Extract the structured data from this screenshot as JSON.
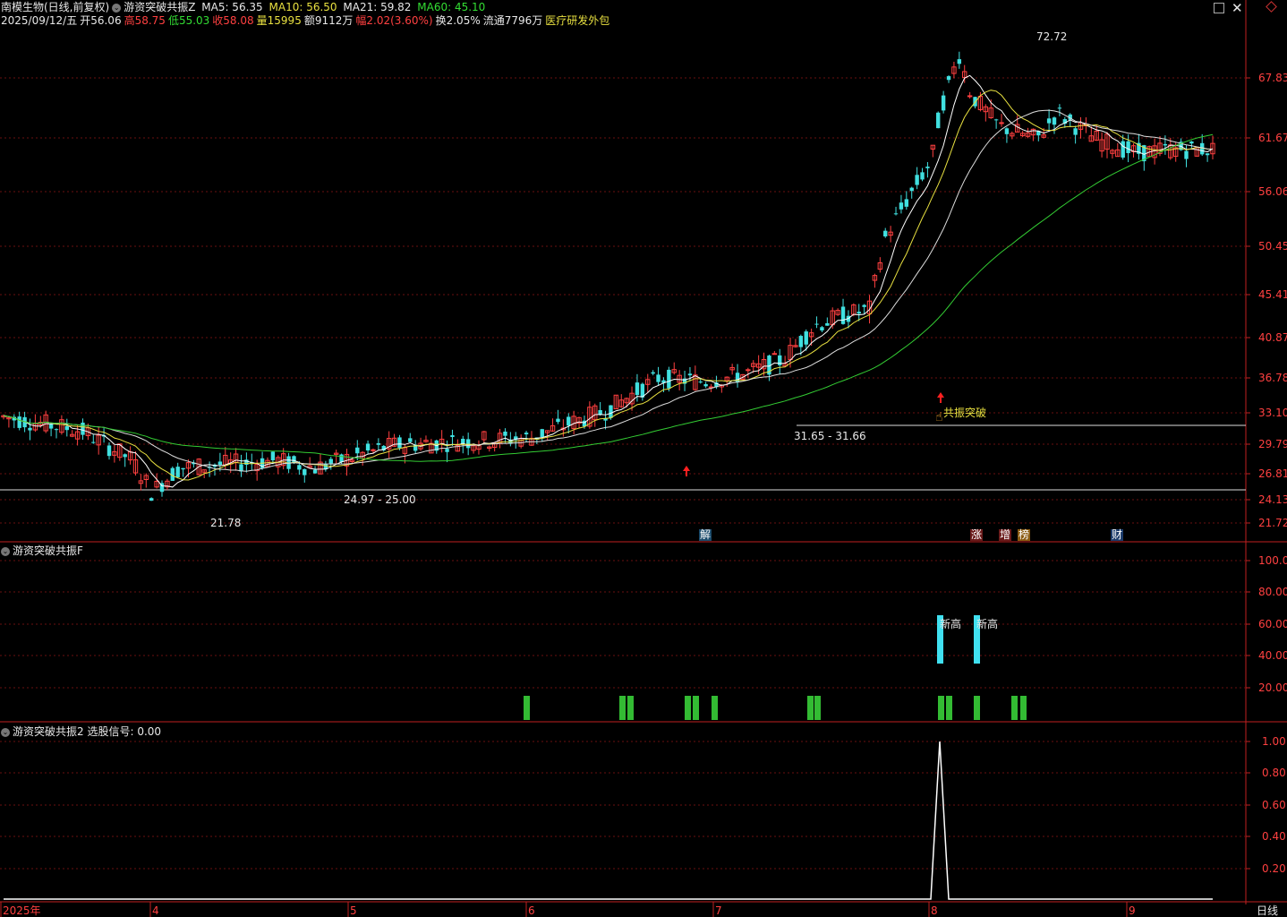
{
  "header": {
    "stock_name": "南模生物(日线,前复权)",
    "indicator_name": "游资突破共振Z",
    "ma5": "MA5: 56.35",
    "ma10": "MA10: 56.50",
    "ma21": "MA21: 59.82",
    "ma60": "MA60: 45.10",
    "date": "2025/09/12/五",
    "open": "开56.06",
    "high": "高58.75",
    "low": "低55.03",
    "close": "收58.08",
    "volume": "量15995",
    "amount": "额9112万",
    "change": "幅2.02(3.60%)",
    "turnover": "换2.05%",
    "float": "流通7796万",
    "sector": "医疗研发外包"
  },
  "main_panel": {
    "y_ticks": [
      "67.83",
      "61.67",
      "56.06",
      "50.45",
      "45.41",
      "40.87",
      "36.78",
      "33.10",
      "29.79",
      "26.81",
      "24.13",
      "21.72"
    ],
    "annotations": {
      "high_label": "72.72",
      "low_label": "21.78",
      "range1": "24.97 - 25.00",
      "range2": "31.65 - 31.66",
      "signal": "共振突破"
    },
    "event_tags": [
      "解",
      "涨",
      "增",
      "榜",
      "财"
    ]
  },
  "panel2": {
    "title": "游资突破共振F",
    "y_ticks": [
      "100.00",
      "80.00",
      "60.00",
      "40.00",
      "20.00"
    ],
    "labels": [
      "新高",
      "新高"
    ]
  },
  "panel3": {
    "title": "游资突破共振2",
    "signal_label": "选股信号: 0.00",
    "y_ticks": [
      "1.00",
      "0.80",
      "0.60",
      "0.40",
      "0.20"
    ]
  },
  "x_axis": {
    "labels": [
      "2025年",
      "4",
      "5",
      "6",
      "7",
      "8",
      "9"
    ],
    "period": "日线"
  },
  "colors": {
    "up": "#ff4040",
    "down": "#40e0e0",
    "ma5": "#ffffff",
    "ma10": "#e8e040",
    "ma21": "#dddddd",
    "ma60": "#33cc33",
    "grid": "#6a1010"
  }
}
